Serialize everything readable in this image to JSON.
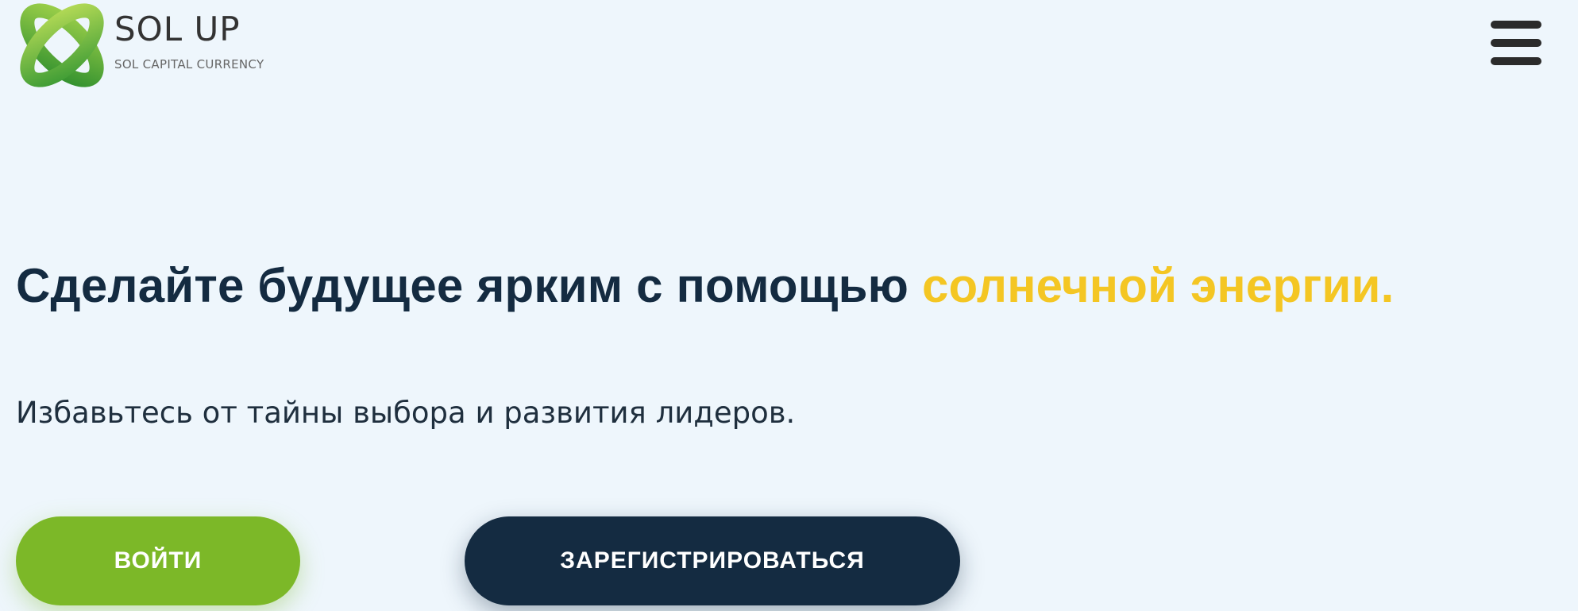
{
  "header": {
    "logo": {
      "name": "SOL UP",
      "tagline": "SOL CAPITAL CURRENCY",
      "icon": "green-clover-logo-icon"
    },
    "menu_icon": "hamburger-menu-icon"
  },
  "hero": {
    "headline_main": "Сделайте будущее ярким с помощью",
    "headline_accent": "солнечной энергии.",
    "subtitle": "Избавьтесь от тайны выбора и развития лидеров."
  },
  "buttons": {
    "login_label": "ВОЙТИ",
    "register_label": "ЗАРЕГИСТРИРОВАТЬСЯ"
  },
  "colors": {
    "background": "#eef6fc",
    "headline": "#142b41",
    "accent": "#f4c623",
    "login_button": "#7cb828",
    "register_button": "#142b41",
    "logo_green": "#5aa82e"
  }
}
